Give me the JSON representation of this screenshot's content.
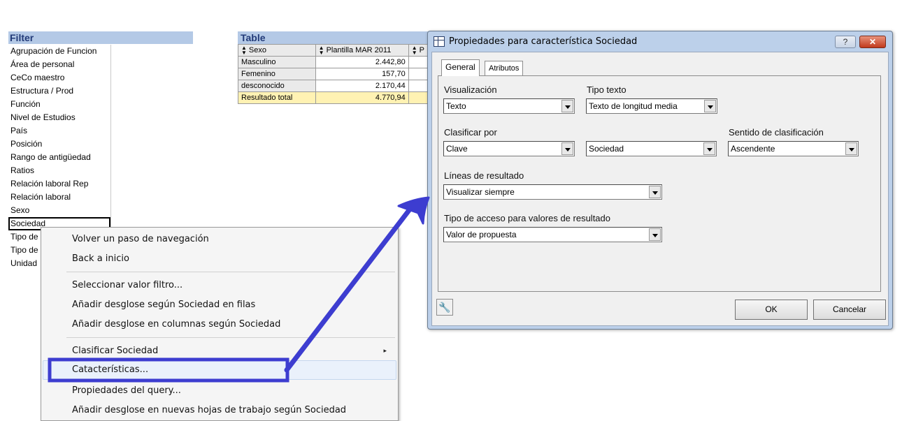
{
  "filter": {
    "title": "Filter",
    "items": [
      "Agrupación de Funcion",
      "Área de personal",
      "CeCo maestro",
      "Estructura / Prod",
      "Función",
      "Nivel de Estudios",
      "País",
      "Posición",
      "Rango de antigüedad",
      "Ratios",
      "Relación laboral Rep",
      "Relación laboral",
      "Sexo",
      "Sociedad",
      "Tipo de",
      "Tipo de",
      "Unidad"
    ]
  },
  "table": {
    "title": "Table",
    "col1_header": "Sexo",
    "col2_header": "Plantilla MAR 2011",
    "col3_header": "P",
    "rows": [
      {
        "label": "Masculino",
        "value": "2.442,80"
      },
      {
        "label": "Femenino",
        "value": "157,70"
      },
      {
        "label": "desconocido",
        "value": "2.170,44"
      }
    ],
    "total": {
      "label": "Resultado total",
      "value": "4.770,94"
    }
  },
  "context_menu": {
    "items": [
      "Volver un paso de navegación",
      "Back a inicio",
      "Seleccionar valor filtro...",
      "Añadir desglose según Sociedad en filas",
      "Añadir desglose en columnas según Sociedad",
      "Clasificar Sociedad",
      "Catacterísticas...",
      "Propiedades del query...",
      "Añadir desglose en nuevas hojas de trabajo según Sociedad"
    ],
    "submenu_arrow": "▸"
  },
  "dialog": {
    "title": "Propiedades para característica Sociedad",
    "help_label": "?",
    "close_label": "✕",
    "tabs": [
      "General",
      "Atributos"
    ],
    "visualizacion": {
      "label": "Visualización",
      "value": "Texto"
    },
    "tipo_texto": {
      "label": "Tipo texto",
      "value": "Texto de longitud media"
    },
    "clasificar": {
      "label": "Clasificar por",
      "value1": "Clave",
      "value2": "Sociedad"
    },
    "sentido": {
      "label": "Sentido de clasificación",
      "value": "Ascendente"
    },
    "lineas": {
      "label": "Líneas de resultado",
      "value": "Visualizar siempre"
    },
    "tipo_acceso": {
      "label": "Tipo de acceso para valores de resultado",
      "value": "Valor de propuesta"
    },
    "ok_label": "OK",
    "cancel_label": "Cancelar",
    "tool_icon": "🔧"
  },
  "colors": {
    "pane_header": "#b4c9e6",
    "total_row": "#fff2b3",
    "dialog_frame": "#bcd0ea",
    "annotation": "#3d3dd0"
  }
}
